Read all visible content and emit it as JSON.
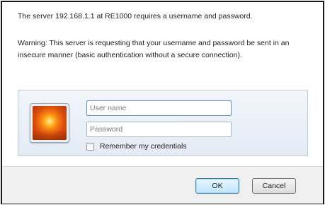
{
  "dialog": {
    "message": "The server 192.168.1.1 at RE1000 requires a username and password.",
    "warning": "Warning: This server is requesting that your username and password be sent in an insecure manner (basic authentication without a secure connection)."
  },
  "credentials": {
    "avatar_icon": "user-avatar-flower-icon",
    "username_placeholder": "User name",
    "password_placeholder": "Password",
    "remember_label": "Remember my credentials",
    "remember_checked": false
  },
  "buttons": {
    "ok_label": "OK",
    "cancel_label": "Cancel"
  },
  "colors": {
    "panel_background": "#e3ebf5",
    "footer_background": "#f0f0f0",
    "default_button_border": "#3c7fb1"
  }
}
